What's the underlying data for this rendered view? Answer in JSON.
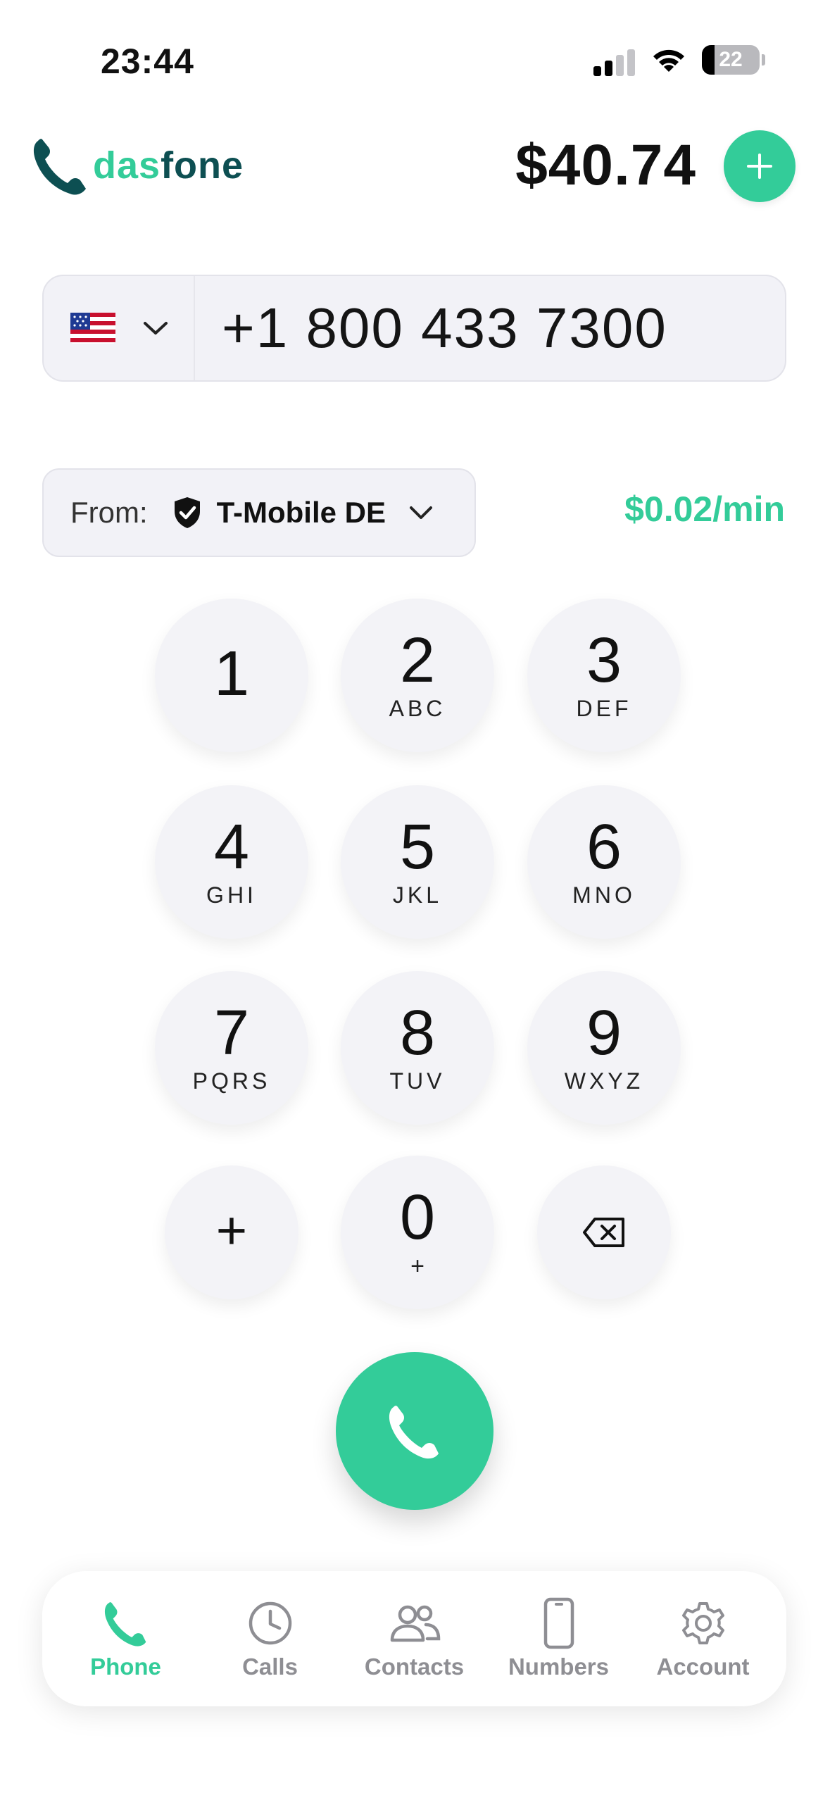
{
  "status_bar": {
    "time": "23:44",
    "battery": "22",
    "battery_level": 0.22
  },
  "header": {
    "brand": "dasfone",
    "balance": "$40.74",
    "add_icon": "plus-icon"
  },
  "dialer": {
    "country_flag": "us-flag-icon",
    "number": "+1 800 433 7300",
    "from_label": "From:",
    "from_value": "T-Mobile DE",
    "rate": "$0.02/min"
  },
  "keypad": [
    {
      "digit": "1",
      "letters": ""
    },
    {
      "digit": "2",
      "letters": "ABC"
    },
    {
      "digit": "3",
      "letters": "DEF"
    },
    {
      "digit": "4",
      "letters": "GHI"
    },
    {
      "digit": "5",
      "letters": "JKL"
    },
    {
      "digit": "6",
      "letters": "MNO"
    },
    {
      "digit": "7",
      "letters": "PQRS"
    },
    {
      "digit": "8",
      "letters": "TUV"
    },
    {
      "digit": "9",
      "letters": "WXYZ"
    },
    {
      "digit": "+",
      "letters": ""
    },
    {
      "digit": "0",
      "letters": "+"
    },
    {
      "digit": "",
      "letters": "",
      "icon": "backspace-icon"
    }
  ],
  "tabs": [
    {
      "label": "Phone",
      "icon": "phone-icon",
      "active": true
    },
    {
      "label": "Calls",
      "icon": "clock-icon",
      "active": false
    },
    {
      "label": "Contacts",
      "icon": "contacts-icon",
      "active": false
    },
    {
      "label": "Numbers",
      "icon": "smartphone-icon",
      "active": false
    },
    {
      "label": "Account",
      "icon": "gear-icon",
      "active": false
    }
  ],
  "colors": {
    "accent": "#33cc99",
    "brand_dark": "#0d4f52",
    "key_bg": "#f3f3f7"
  }
}
